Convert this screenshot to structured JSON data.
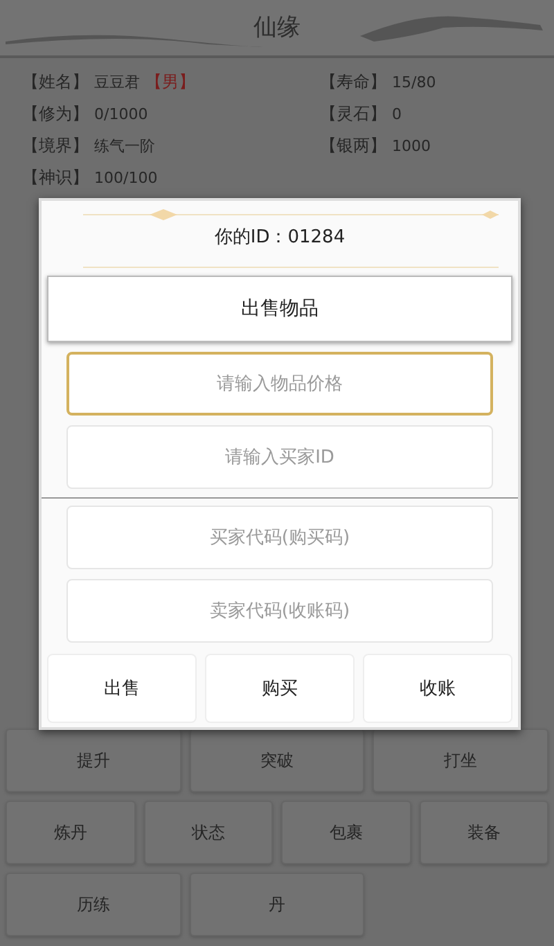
{
  "header": {
    "title": "仙缘"
  },
  "stats": [
    {
      "label": "【姓名】",
      "value": "豆豆君",
      "tag": "【男】"
    },
    {
      "label": "【寿命】",
      "value": "15/80"
    },
    {
      "label": "【修为】",
      "value": "0/1000"
    },
    {
      "label": "【灵石】",
      "value": "0"
    },
    {
      "label": "【境界】",
      "value": "练气一阶"
    },
    {
      "label": "【银两】",
      "value": "1000"
    },
    {
      "label": "【神识】",
      "value": "100/100"
    }
  ],
  "actions": [
    {
      "buttons": [
        "提升",
        "突破",
        "打坐"
      ]
    },
    {
      "buttons": [
        "炼丹",
        "状态",
        "包裹",
        "装备"
      ]
    },
    {
      "buttons": [
        "历练",
        "丹"
      ]
    }
  ],
  "dialog": {
    "id_label": "你的ID：01284",
    "title": "出售物品",
    "fields": [
      {
        "placeholder": "请输入物品价格",
        "focused": true
      },
      {
        "placeholder": "请输入买家ID",
        "focused": false
      },
      {
        "placeholder": "买家代码(购买码)",
        "focused": false
      },
      {
        "placeholder": "卖家代码(收账码)",
        "focused": false
      }
    ],
    "buttons": [
      "出售",
      "购买",
      "收账"
    ]
  }
}
